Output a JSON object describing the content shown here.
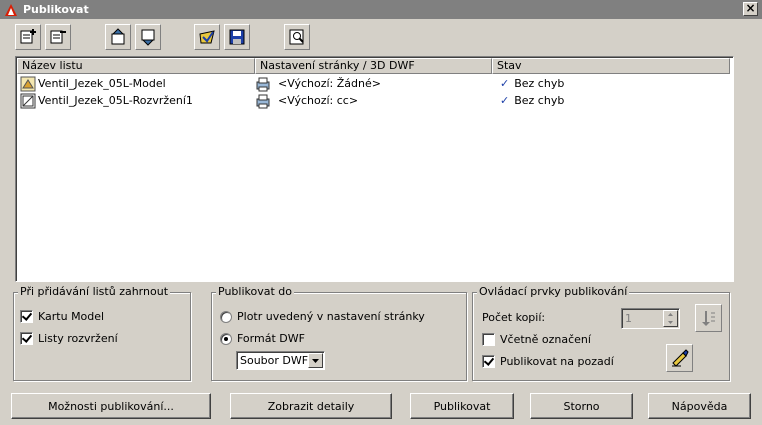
{
  "window": {
    "title": "Publikovat",
    "close": "×"
  },
  "list": {
    "columns": [
      "Název listu",
      "Nastavení stránky / 3D DWF",
      "Stav"
    ],
    "rows": [
      {
        "name": "Ventil_Jezek_05L-Model",
        "setup": "<Výchozí: Žádné>",
        "status": "Bez chyb"
      },
      {
        "name": "Ventil_Jezek_05L-Rozvržení1",
        "setup": "<Výchozí: cc>",
        "status": "Bez chyb"
      }
    ]
  },
  "group_include": {
    "title": "Při přidávání listů zahrnout",
    "model_tab": "Kartu Model",
    "layouts": "Listy rozvržení"
  },
  "group_publish_to": {
    "title": "Publikovat do",
    "plotter": "Plotr uvedený v nastavení stránky",
    "dwf_format": "Formát DWF",
    "dwf_select": "Soubor DWF"
  },
  "group_controls": {
    "title": "Ovládací prvky publikování",
    "copies_label": "Počet kopií:",
    "copies_value": "1",
    "include_stamp": "Včetně označení",
    "background": "Publikovat na pozadí"
  },
  "buttons": {
    "options": "Možnosti publikování...",
    "details": "Zobrazit detaily",
    "publish": "Publikovat",
    "cancel": "Storno",
    "help": "Nápověda"
  },
  "colors": {
    "title_bar": "#808080",
    "dialog_bg": "#d4d0c8",
    "check_blue": "#1c3fa8"
  }
}
